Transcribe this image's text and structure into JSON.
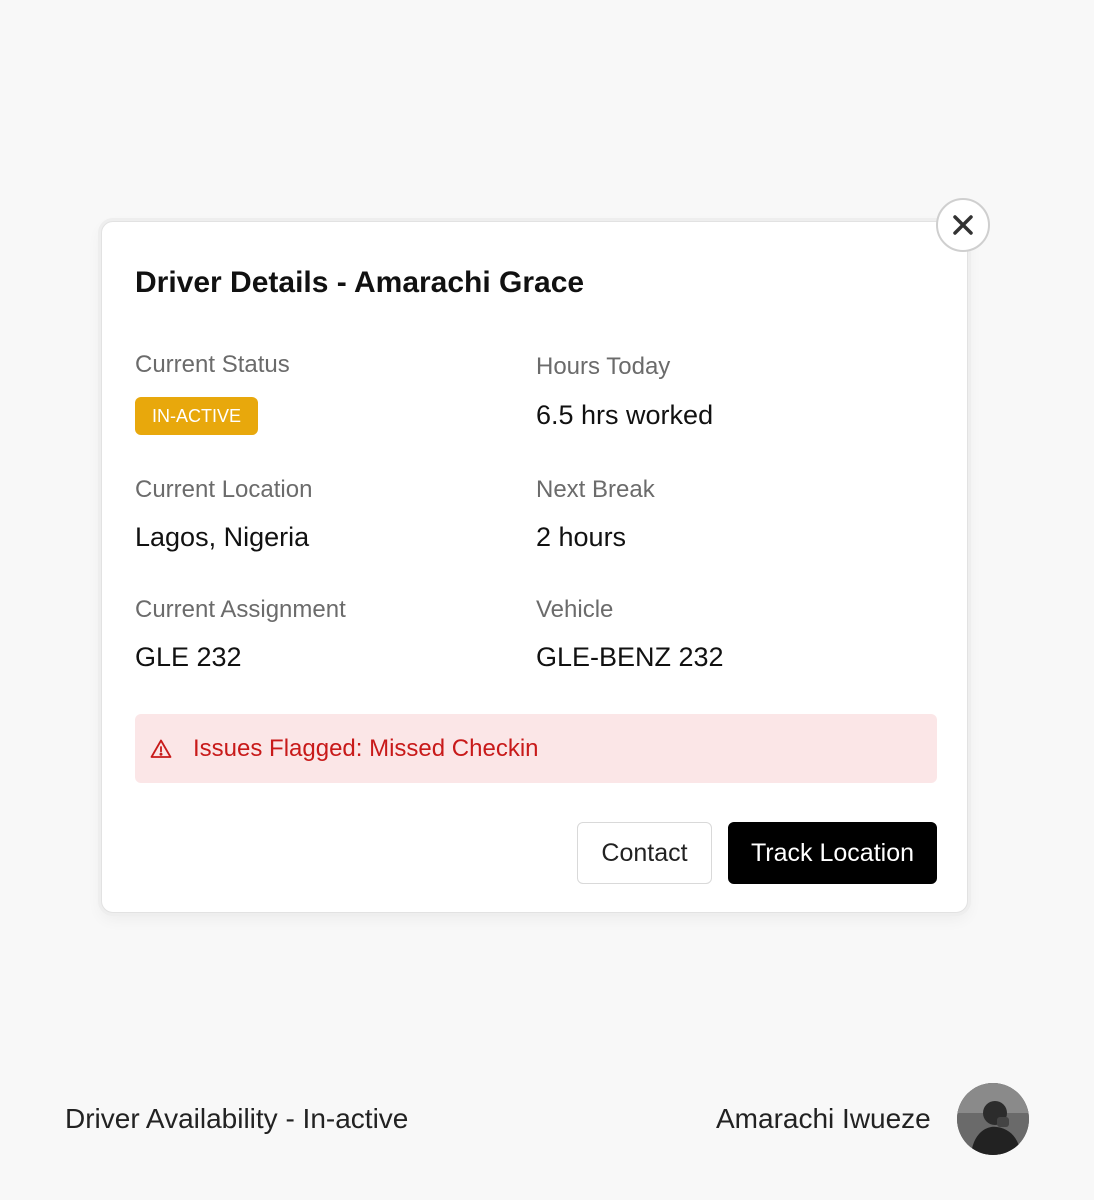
{
  "modal": {
    "title": "Driver Details - Amarachi Grace",
    "fields": {
      "current_status": {
        "label": "Current Status",
        "badge": "IN-ACTIVE"
      },
      "hours_today": {
        "label": "Hours Today",
        "value": "6.5 hrs worked"
      },
      "current_location": {
        "label": "Current Location",
        "value": "Lagos, Nigeria"
      },
      "next_break": {
        "label": "Next Break",
        "value": "2 hours"
      },
      "current_assignment": {
        "label": "Current Assignment",
        "value": "GLE 232"
      },
      "vehicle": {
        "label": "Vehicle",
        "value": "GLE-BENZ 232"
      }
    },
    "alert": {
      "icon": "warning-icon",
      "text": "Issues Flagged: Missed Checkin"
    },
    "actions": {
      "contact_label": "Contact",
      "track_label": "Track Location"
    },
    "close_icon": "close-icon"
  },
  "footer": {
    "caption": "Driver Availability - In-active",
    "author": "Amarachi Iwueze"
  },
  "colors": {
    "badge": "#e8a80c",
    "alert_bg": "#fbe6e7",
    "alert_text": "#c81a1a",
    "primary_button": "#000000",
    "page_bg": "#f8f8f8"
  }
}
